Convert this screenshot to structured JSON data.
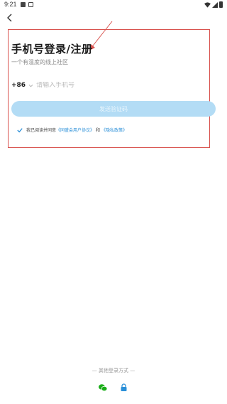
{
  "status_bar": {
    "time": "9:21"
  },
  "header": {
    "title": "手机号登录/注册",
    "subtitle": "一个有温度的线上社区"
  },
  "form": {
    "country_code": "+86",
    "phone_placeholder": "请输入手机号",
    "send_button_label": "发送验证码"
  },
  "agreement": {
    "prefix": "我已阅读并同意",
    "user_agreement": "《同盛会用户协议》",
    "conjunction": "和",
    "privacy_policy": "《隐私政策》"
  },
  "other_login": {
    "label": "— 其他登录方式 —",
    "methods": [
      "wechat-icon",
      "lock-icon"
    ]
  },
  "colors": {
    "accent": "#2a8fd8",
    "button_disabled": "#b3dcf5",
    "annotation": "#d9534f",
    "wechat_green": "#1aad19"
  }
}
